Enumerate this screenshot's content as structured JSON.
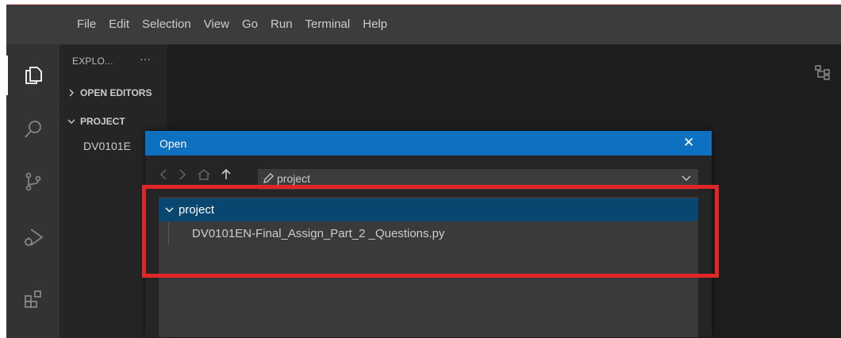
{
  "menubar": {
    "items": [
      "File",
      "Edit",
      "Selection",
      "View",
      "Go",
      "Run",
      "Terminal",
      "Help"
    ]
  },
  "activitybar": {
    "icons": [
      "explorer-icon",
      "search-icon",
      "source-control-icon",
      "run-debug-icon",
      "extensions-icon"
    ]
  },
  "sidebar": {
    "title": "EXPLO...",
    "more": "···",
    "open_editors": "OPEN EDITORS",
    "project": "PROJECT",
    "file": "DV0101E"
  },
  "dialog": {
    "title": "Open",
    "close": "✕",
    "path": "project",
    "tree_folder": "project",
    "tree_file": "DV0101EN-Final_Assign_Part_2 _Questions.py"
  },
  "colors": {
    "accent": "#0e70c0",
    "selection": "#094771",
    "highlight_box": "#e02626"
  }
}
